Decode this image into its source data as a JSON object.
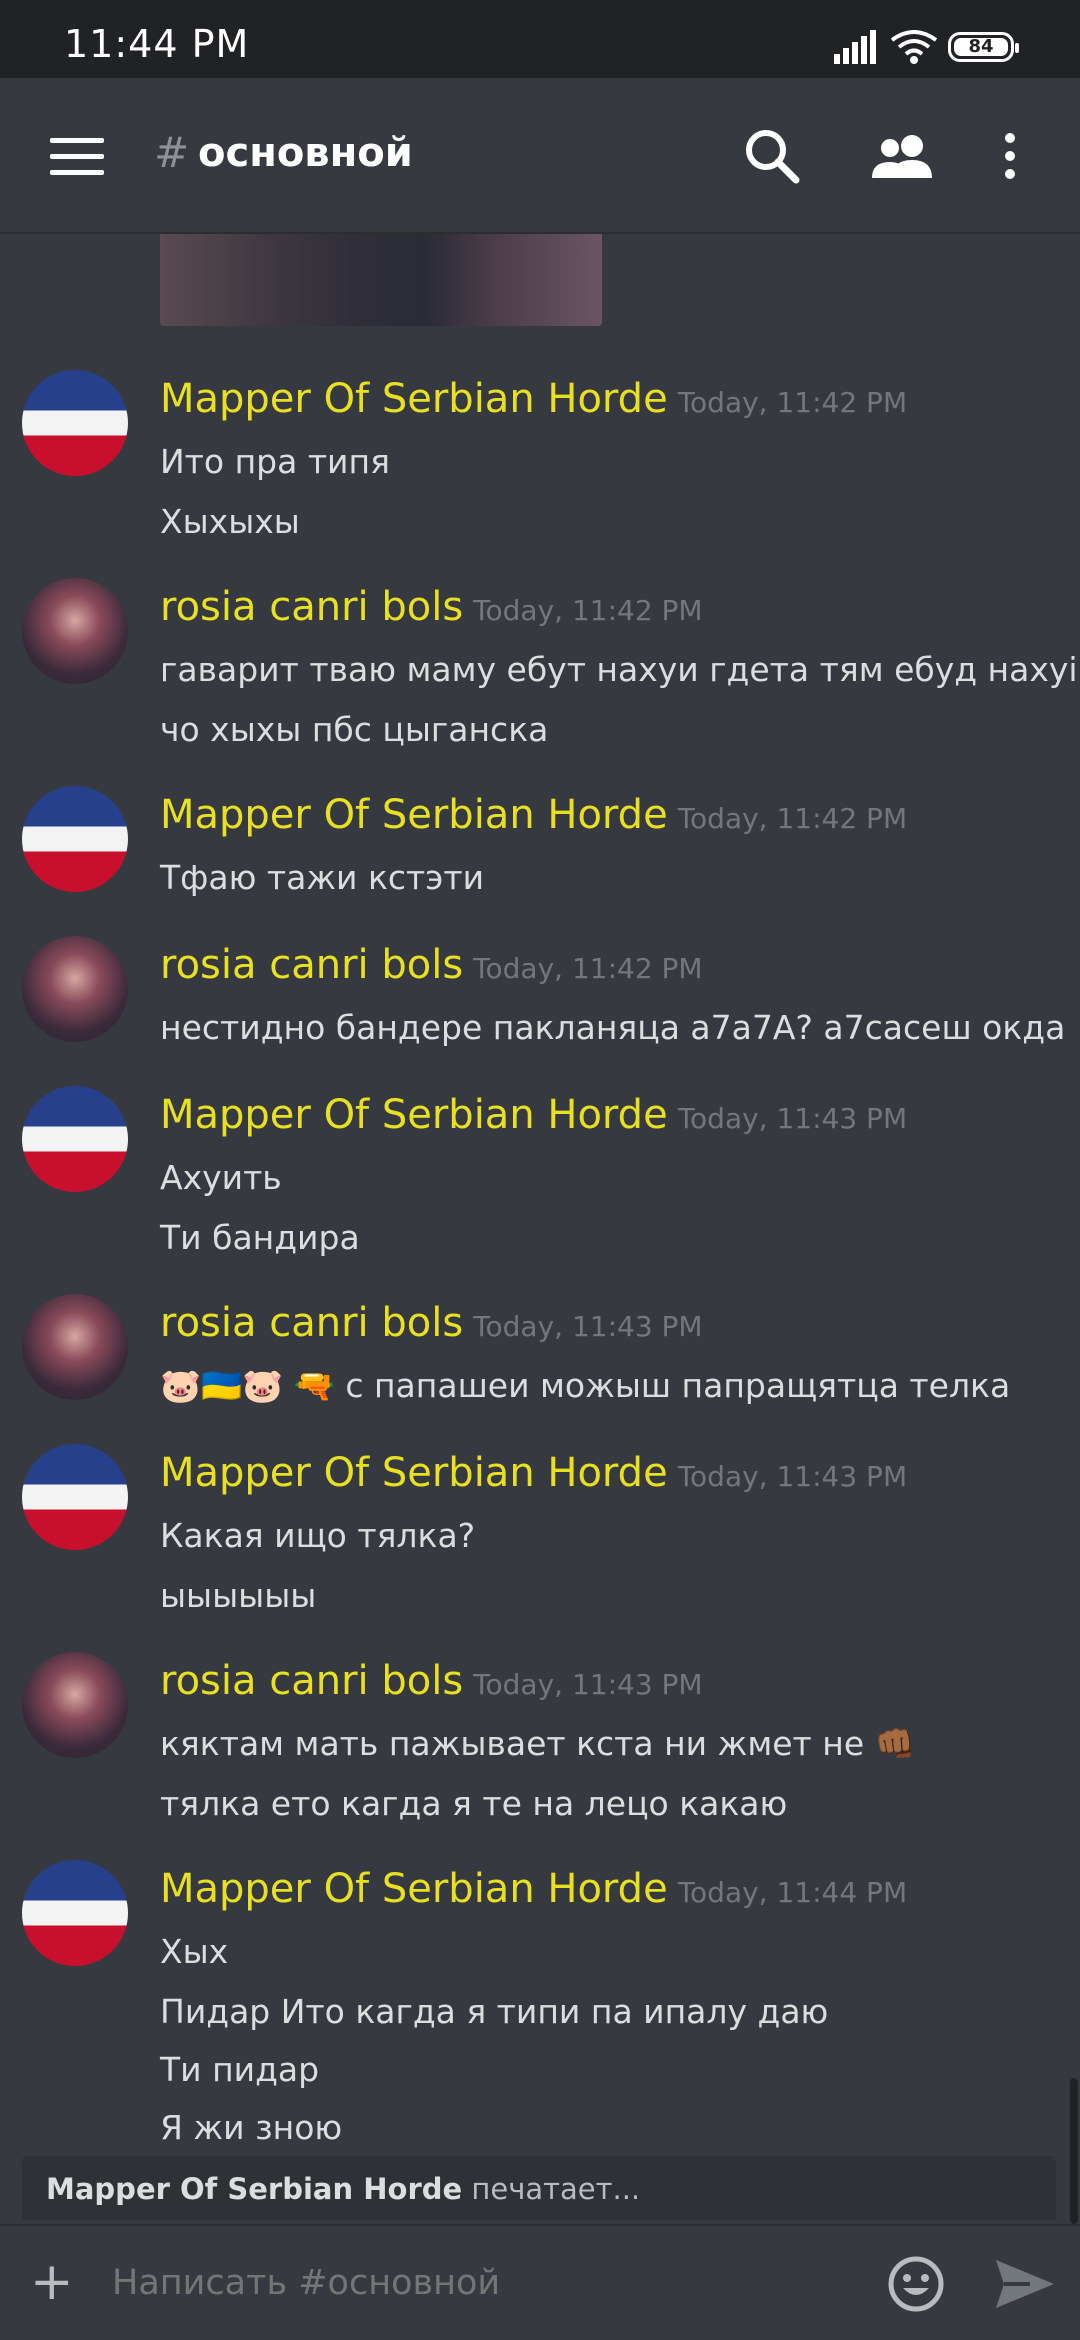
{
  "status_bar": {
    "time": "11:44 PM",
    "battery": "84"
  },
  "header": {
    "hash": "#",
    "channel_name": "основной"
  },
  "messages": [
    {
      "author": "Mapper Of Serbian Horde",
      "timestamp": "Today, 11:42 PM",
      "avatar": "serbia-ball",
      "lines": [
        "Ито пра типя",
        "Хыхыхы"
      ]
    },
    {
      "author": "rosia canri bols",
      "timestamp": "Today, 11:42 PM",
      "avatar": "photo",
      "lines": [
        "гаварит тваю маму ебут нахуи гдета тям ебуд нахуі",
        "чо хыхы пбс цыганска"
      ]
    },
    {
      "author": "Mapper Of Serbian Horde",
      "timestamp": "Today, 11:42 PM",
      "avatar": "serbia-ball",
      "lines": [
        "Тфаю тажи кстэти"
      ]
    },
    {
      "author": "rosia canri bols",
      "timestamp": "Today, 11:42 PM",
      "avatar": "photo",
      "lines": [
        "нестидно бандере пакланяца а7а7А? а7сасеш окда"
      ]
    },
    {
      "author": "Mapper Of Serbian Horde",
      "timestamp": "Today, 11:43 PM",
      "avatar": "serbia-ball",
      "lines": [
        "Ахуить",
        "Ти бандира"
      ]
    },
    {
      "author": "rosia canri bols",
      "timestamp": "Today, 11:43 PM",
      "avatar": "photo",
      "lines": [
        "🐷🇺🇦🐷 🔫 с папашеи можыш папращятца телка"
      ]
    },
    {
      "author": "Mapper Of Serbian Horde",
      "timestamp": "Today, 11:43 PM",
      "avatar": "serbia-ball",
      "lines": [
        "Какая ищо тялка?",
        "ыыыыыы"
      ]
    },
    {
      "author": "rosia canri bols",
      "timestamp": "Today, 11:43 PM",
      "avatar": "photo",
      "lines": [
        "кяктам мать пажывает кста ни жмет не 👊🏾",
        "тялка ето кагда я те на лецо какаю"
      ]
    },
    {
      "author": "Mapper Of Serbian Horde",
      "timestamp": "Today, 11:44 PM",
      "avatar": "serbia-ball",
      "lines": [
        "Хых",
        "Пидар Ито кагда я типи па ипалу даю",
        "Ти пидар",
        "Я жи зною"
      ]
    }
  ],
  "typing": {
    "user": "Mapper Of Serbian Horde",
    "text": " печатает..."
  },
  "composer": {
    "placeholder": "Написать #основной"
  },
  "colors": {
    "author": "#e8e020",
    "background": "#36393f",
    "status_bar": "#202225"
  }
}
